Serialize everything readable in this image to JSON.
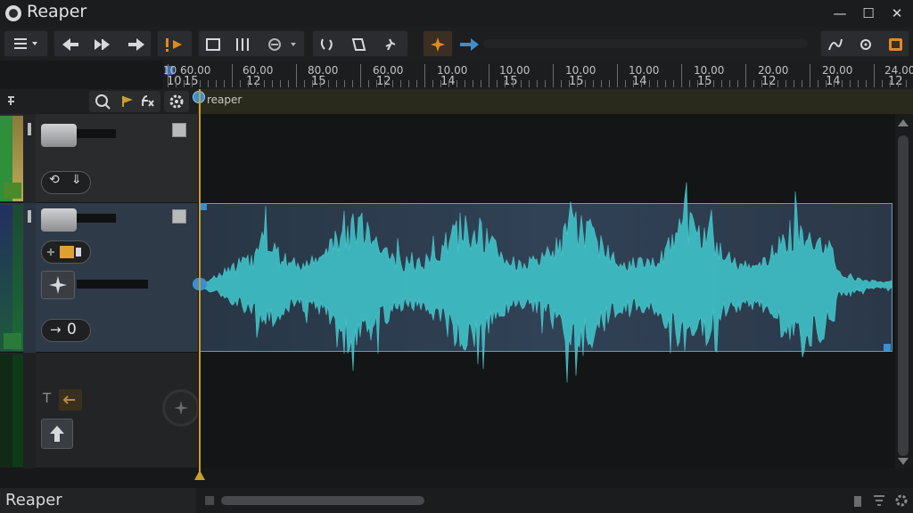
{
  "window": {
    "title": "Reaper",
    "controls": {
      "minimize": "—",
      "maximize": "☐",
      "close": "✕"
    }
  },
  "ruler": {
    "top_labels": [
      "10",
      "60.00",
      "60.00",
      "80.00",
      "60.00",
      "10.00",
      "10.00",
      "10.00",
      "10.00",
      "10.00",
      "20.00",
      "20.00",
      "24.00"
    ],
    "bottom_labels": [
      "10",
      "15",
      "12",
      "15",
      "12",
      "14",
      "15",
      "15",
      "14",
      "15",
      "12",
      "14",
      "12"
    ]
  },
  "timeline": {
    "marker_label": "reaper"
  },
  "tracks": [
    {
      "id": 1,
      "buttons": [
        "⟲",
        "⇓"
      ]
    },
    {
      "id": 2,
      "pan_value": "0"
    },
    {
      "id": 3,
      "label_t": "T"
    }
  ],
  "status": {
    "text": "Reaper"
  },
  "colors": {
    "accent_orange": "#e08b1e",
    "accent_blue": "#3b8fd0",
    "waveform": "#3fc2c8",
    "playhead": "#c9a02a"
  }
}
